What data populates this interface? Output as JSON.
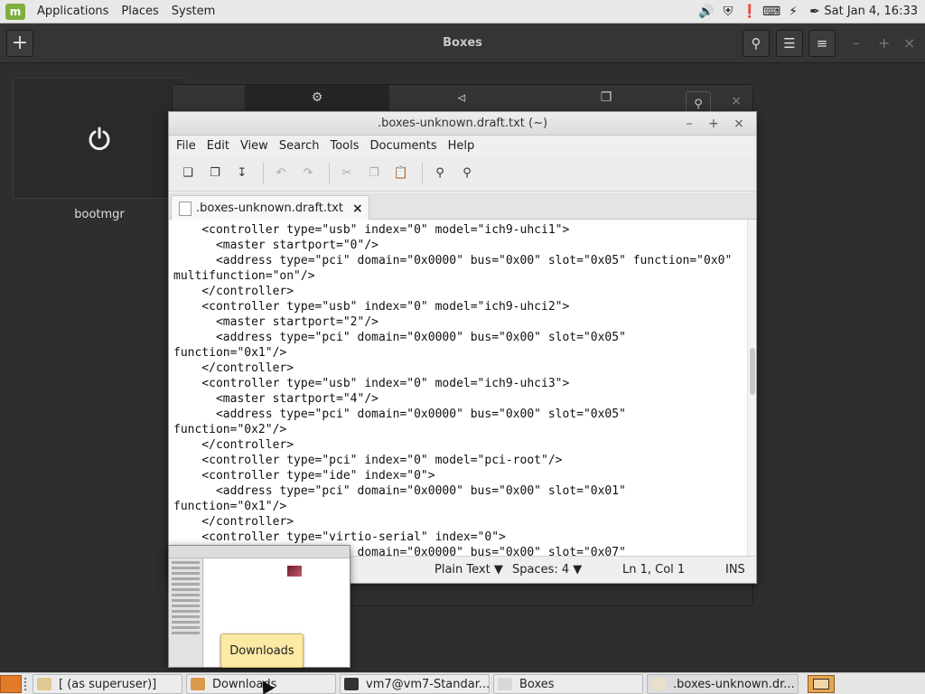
{
  "top_panel": {
    "menus": [
      "Applications",
      "Places",
      "System"
    ],
    "clock": "Sat Jan  4, 16:33",
    "tray_icons": [
      "volume-icon",
      "shield-icon",
      "update-icon",
      "keyboard-icon",
      "network-icon",
      "pen-icon"
    ]
  },
  "boxes": {
    "title": "Boxes",
    "vm_name": "bootmgr"
  },
  "gedit": {
    "title": ".boxes-unknown.draft.txt (~)",
    "menus": [
      "File",
      "Edit",
      "View",
      "Search",
      "Tools",
      "Documents",
      "Help"
    ],
    "tab_label": ".boxes-unknown.draft.txt",
    "lines": [
      "    <controller type=\"usb\" index=\"0\" model=\"ich9-uhci1\">",
      "      <master startport=\"0\"/>",
      "      <address type=\"pci\" domain=\"0x0000\" bus=\"0x00\" slot=\"0x05\" function=\"0x0\"",
      "multifunction=\"on\"/>",
      "    </controller>",
      "    <controller type=\"usb\" index=\"0\" model=\"ich9-uhci2\">",
      "      <master startport=\"2\"/>",
      "      <address type=\"pci\" domain=\"0x0000\" bus=\"0x00\" slot=\"0x05\"",
      "function=\"0x1\"/>",
      "    </controller>",
      "    <controller type=\"usb\" index=\"0\" model=\"ich9-uhci3\">",
      "      <master startport=\"4\"/>",
      "      <address type=\"pci\" domain=\"0x0000\" bus=\"0x00\" slot=\"0x05\"",
      "function=\"0x2\"/>",
      "    </controller>",
      "    <controller type=\"pci\" index=\"0\" model=\"pci-root\"/>",
      "    <controller type=\"ide\" index=\"0\">",
      "      <address type=\"pci\" domain=\"0x0000\" bus=\"0x00\" slot=\"0x01\"",
      "function=\"0x1\"/>",
      "    </controller>",
      "    <controller type=\"virtio-serial\" index=\"0\">",
      "      <address type=\"pci\" domain=\"0x0000\" bus=\"0x00\" slot=\"0x07\""
    ],
    "status": {
      "language": "Plain Text",
      "indent": "Spaces: 4",
      "position": "Ln 1, Col 1",
      "mode": "INS"
    }
  },
  "tooltip": "Downloads",
  "taskbar": {
    "tasks": [
      {
        "label": "[ (as superuser)]",
        "icon": "file-manager-icon",
        "color": "#e0c890"
      },
      {
        "label": "Downloads",
        "icon": "folder-icon",
        "color": "#d89a4a"
      },
      {
        "label": "vm7@vm7-Standar...",
        "icon": "terminal-icon",
        "color": "#333333"
      },
      {
        "label": "Boxes",
        "icon": "boxes-icon",
        "color": "#d8d8d8"
      },
      {
        "label": ".boxes-unknown.dr...",
        "icon": "text-editor-icon",
        "color": "#e8e0c8"
      }
    ]
  }
}
